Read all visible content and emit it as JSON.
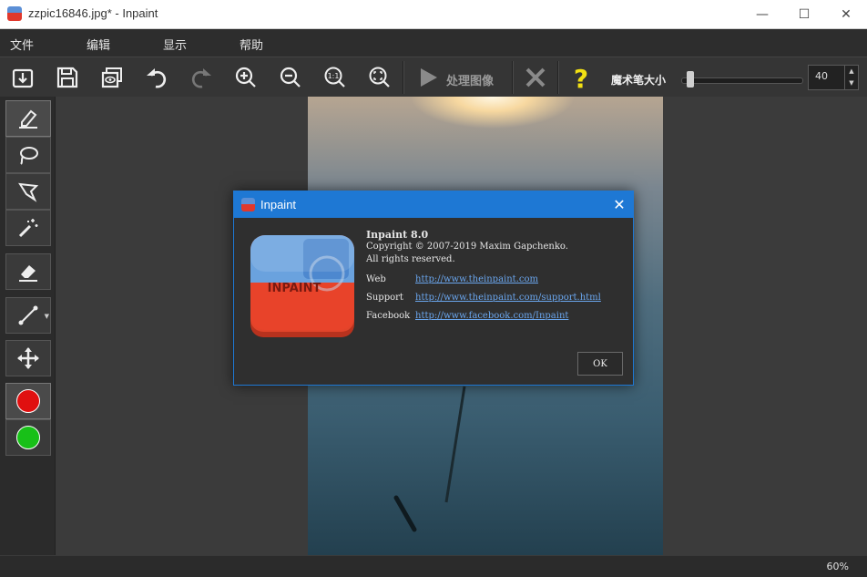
{
  "window": {
    "title": "zzpic16846.jpg* - Inpaint",
    "minimize": "—",
    "maximize": "☐",
    "close": "✕"
  },
  "menu": [
    "文件",
    "编辑",
    "显示",
    "帮助"
  ],
  "toolbar": {
    "process_label": "处理图像",
    "brush_size_label": "魔术笔大小",
    "brush_size_value": "40",
    "brush_size_fraction": 0.04
  },
  "sidebar": {
    "tools": [
      "marker-tool",
      "lasso-tool",
      "polygon-lasso-tool",
      "magic-wand-tool",
      "eraser-tool",
      "line-tool",
      "move-tool"
    ],
    "colors": {
      "remove": "#e01010",
      "keep": "#18c018"
    }
  },
  "status": {
    "zoom": "60%"
  },
  "about": {
    "title": "Inpaint",
    "product": "Inpaint 8.0",
    "copyright": "Copyright © 2007-2019 Maxim Gapchenko.",
    "rights": "All rights reserved.",
    "web_label": "Web",
    "web_url": "http://www.theinpaint.com",
    "support_label": "Support",
    "support_url": "http://www.theinpaint.com/support.html",
    "facebook_label": "Facebook",
    "facebook_url": "http://www.facebook.com/Inpaint",
    "logo_text": "INPAINT",
    "ok": "OK"
  },
  "colors": {
    "accent": "#1e78d4",
    "link": "#6aa6ee"
  }
}
